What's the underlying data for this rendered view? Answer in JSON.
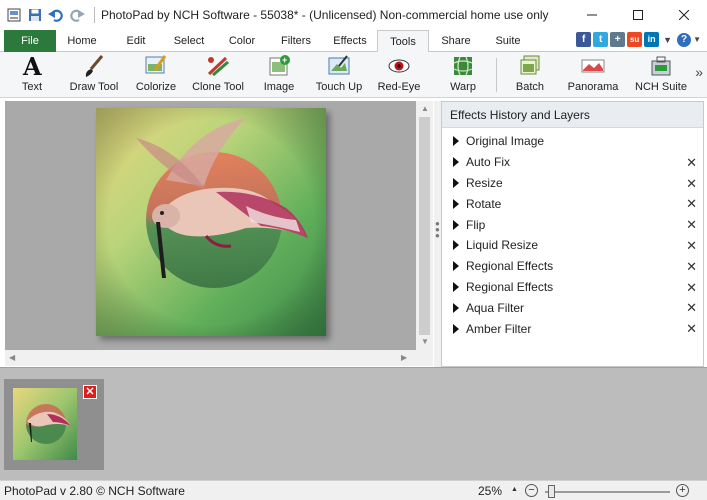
{
  "window": {
    "title": "PhotoPad by NCH Software - 55038* - (Unlicensed) Non-commercial home use only"
  },
  "quick_access": [
    "app-menu-icon",
    "save-icon",
    "undo-icon",
    "redo-icon"
  ],
  "tabs": [
    {
      "label": "File"
    },
    {
      "label": "Home"
    },
    {
      "label": "Edit"
    },
    {
      "label": "Select"
    },
    {
      "label": "Color"
    },
    {
      "label": "Filters"
    },
    {
      "label": "Effects"
    },
    {
      "label": "Tools",
      "active": true
    },
    {
      "label": "Share"
    },
    {
      "label": "Suite"
    }
  ],
  "social_labels": [
    "f",
    "t",
    "+",
    "su",
    "in"
  ],
  "tools": [
    {
      "label": "Text",
      "icon": "text-icon"
    },
    {
      "label": "Draw Tool",
      "icon": "brush-icon"
    },
    {
      "label": "Colorize",
      "icon": "colorize-icon"
    },
    {
      "label": "Clone Tool",
      "icon": "clone-icon"
    },
    {
      "label": "Image",
      "icon": "image-icon"
    },
    {
      "label": "Touch Up",
      "icon": "touch-up-icon"
    },
    {
      "label": "Red-Eye",
      "icon": "red-eye-icon"
    },
    {
      "label": "Warp",
      "icon": "warp-icon"
    },
    {
      "label": "Batch",
      "icon": "batch-icon"
    },
    {
      "label": "Panorama",
      "icon": "panorama-icon"
    },
    {
      "label": "NCH Suite",
      "icon": "nch-suite-icon"
    }
  ],
  "panel": {
    "title": "Effects History and Layers",
    "layers": [
      {
        "name": "Original Image",
        "removable": false
      },
      {
        "name": "Auto Fix",
        "removable": true
      },
      {
        "name": "Resize",
        "removable": true
      },
      {
        "name": "Rotate",
        "removable": true
      },
      {
        "name": "Flip",
        "removable": true
      },
      {
        "name": "Liquid Resize",
        "removable": true
      },
      {
        "name": "Regional Effects",
        "removable": true
      },
      {
        "name": "Regional Effects",
        "removable": true
      },
      {
        "name": "Aqua Filter",
        "removable": true
      },
      {
        "name": "Amber Filter",
        "removable": true
      }
    ]
  },
  "status": {
    "version": "PhotoPad v 2.80 © NCH Software",
    "zoom": "25%"
  },
  "colors": {
    "file_tab": "#2b7a3c",
    "canvas_bg": "#a9a9a9",
    "close_red": "#e21b1b"
  }
}
